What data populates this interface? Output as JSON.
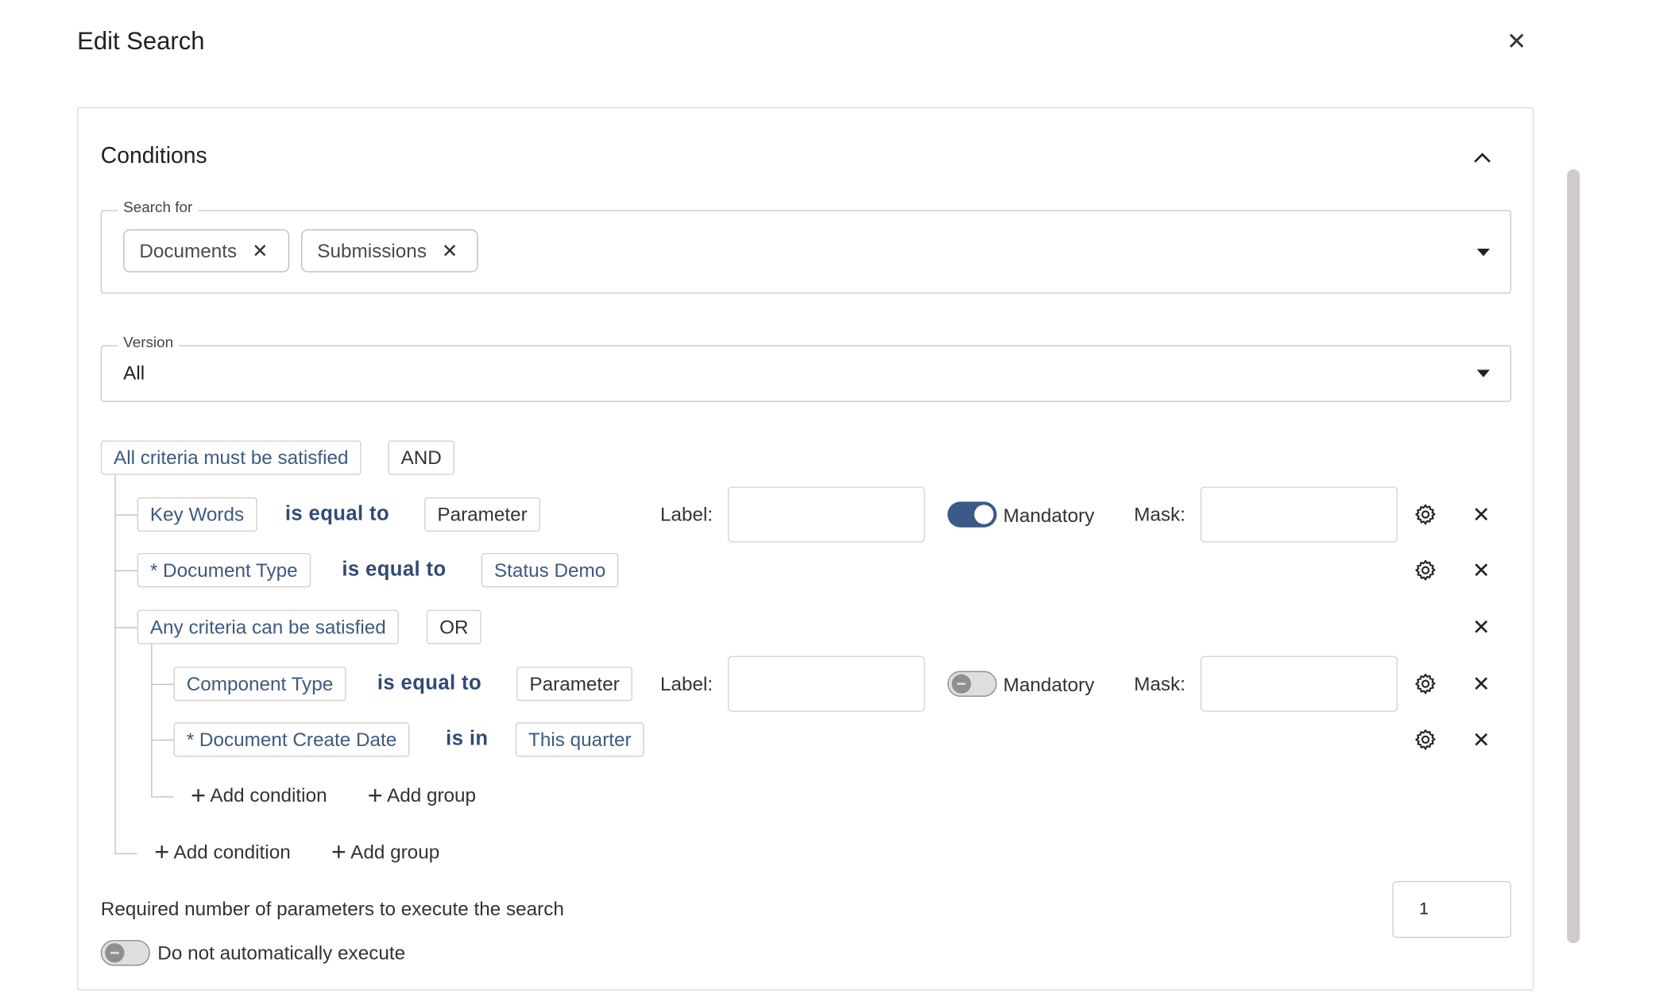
{
  "dialog": {
    "title": "Edit Search",
    "close_icon": "close-icon"
  },
  "conditions": {
    "title": "Conditions",
    "search_for": {
      "label": "Search for",
      "chips": [
        {
          "label": "Documents"
        },
        {
          "label": "Submissions"
        }
      ]
    },
    "version": {
      "label": "Version",
      "value": "All"
    },
    "root_group": {
      "criteria": "All criteria must be satisfied",
      "operator": "AND"
    },
    "rows": {
      "r1": {
        "field": "Key Words",
        "op": "is equal to",
        "value": "Parameter",
        "label_text": "Label:",
        "label_value": "",
        "mandatory": "Mandatory",
        "mandatory_on": true,
        "mask_text": "Mask:",
        "mask_value": ""
      },
      "r2": {
        "field": "* Document Type",
        "op": "is equal to",
        "value": "Status Demo"
      },
      "sub_group": {
        "criteria": "Any criteria can be satisfied",
        "operator": "OR"
      },
      "r3": {
        "field": "Component Type",
        "op": "is equal to",
        "value": "Parameter",
        "label_text": "Label:",
        "label_value": "",
        "mandatory": "Mandatory",
        "mandatory_on": false,
        "mask_text": "Mask:",
        "mask_value": ""
      },
      "r4": {
        "field": "* Document Create Date",
        "op": "is in",
        "value": "This quarter"
      }
    },
    "inner_add": {
      "add_condition": "Add condition",
      "add_group": "Add group"
    },
    "outer_add": {
      "add_condition": "Add condition",
      "add_group": "Add group"
    },
    "required_params": {
      "label": "Required number of parameters to execute the search",
      "value": "1"
    },
    "auto_execute": {
      "label": "Do not automatically execute",
      "on": false
    }
  }
}
